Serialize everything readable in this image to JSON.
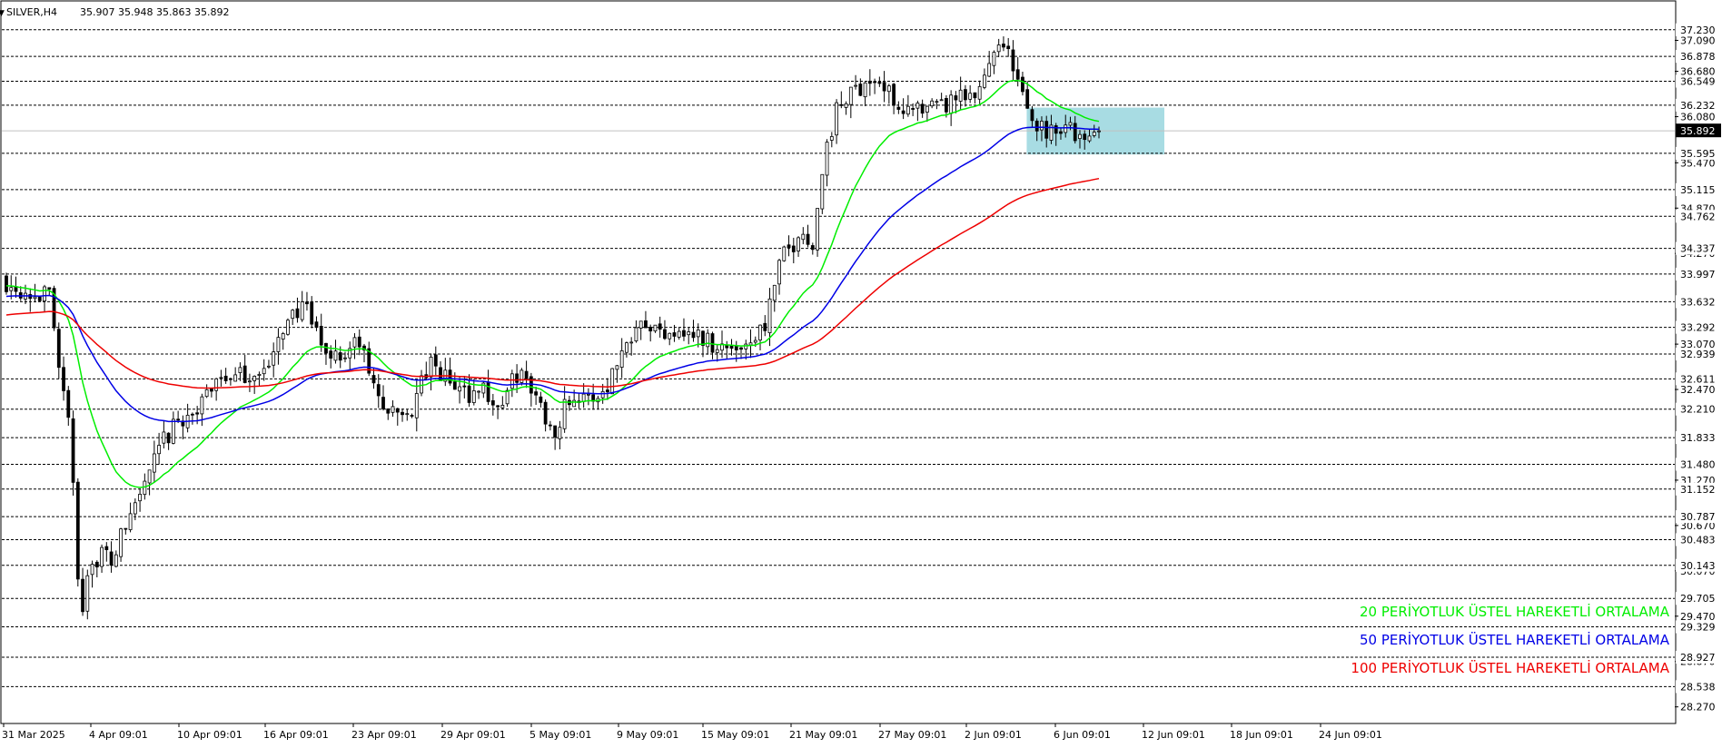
{
  "header": {
    "symbol": "SILVER,H4",
    "ohlc": "35.907 35.948 35.863 35.892"
  },
  "chart_data": {
    "type": "candlestick",
    "symbol": "SILVER",
    "timeframe": "H4",
    "y_range": [
      28.05,
      37.6
    ],
    "x_ticks": [
      "31 Mar 2025",
      "4 Apr 09:01",
      "10 Apr 09:01",
      "16 Apr 09:01",
      "23 Apr 09:01",
      "29 Apr 09:01",
      "5 May 09:01",
      "9 May 09:01",
      "15 May 09:01",
      "21 May 09:01",
      "27 May 09:01",
      "2 Jun 09:01",
      "6 Jun 09:01",
      "12 Jun 09:01",
      "18 Jun 09:01",
      "24 Jun 09:01"
    ],
    "y_ticks": [
      "37.090",
      "36.680",
      "36.080",
      "35.470",
      "34.870",
      "34.270",
      "33.070",
      "32.470",
      "31.270",
      "30.670",
      "30.070",
      "29.470",
      "28.870",
      "28.270"
    ],
    "levels": [
      {
        "label": "37.230",
        "value": 37.23
      },
      {
        "label": "36.878",
        "value": 36.878
      },
      {
        "label": "36.549",
        "value": 36.549
      },
      {
        "label": "36.232",
        "value": 36.232
      },
      {
        "label": "35.595",
        "value": 35.595
      },
      {
        "label": "35.115",
        "value": 35.115
      },
      {
        "label": "34.762",
        "value": 34.762
      },
      {
        "label": "34.337",
        "value": 34.337
      },
      {
        "label": "33.997",
        "value": 33.997
      },
      {
        "label": "33.632",
        "value": 33.632
      },
      {
        "label": "33.292",
        "value": 33.292
      },
      {
        "label": "32.939",
        "value": 32.939
      },
      {
        "label": "32.611",
        "value": 32.611
      },
      {
        "label": "32.210",
        "value": 32.21
      },
      {
        "label": "31.833",
        "value": 31.833
      },
      {
        "label": "31.480",
        "value": 31.48
      },
      {
        "label": "31.152",
        "value": 31.152
      },
      {
        "label": "30.787",
        "value": 30.787
      },
      {
        "label": "30.483",
        "value": 30.483
      },
      {
        "label": "30.143",
        "value": 30.143
      },
      {
        "label": "29.705",
        "value": 29.705
      },
      {
        "label": "29.329",
        "value": 29.329
      },
      {
        "label": "28.927",
        "value": 28.927
      },
      {
        "label": "28.538",
        "value": 28.538
      }
    ],
    "current_price": {
      "label": "35.892",
      "value": 35.892
    },
    "zone": {
      "low": 35.58,
      "high": 36.2,
      "start_x_label": "18 Jun 09:01",
      "color": "#a8dce3"
    },
    "close_path": [
      {
        "t": 0.0,
        "v": 33.9
      },
      {
        "t": 1.5,
        "v": 33.75
      },
      {
        "t": 2.5,
        "v": 33.7
      },
      {
        "t": 3.2,
        "v": 32.5
      },
      {
        "t": 3.7,
        "v": 31.7
      },
      {
        "t": 4.0,
        "v": 30.2
      },
      {
        "t": 4.2,
        "v": 29.4
      },
      {
        "t": 4.6,
        "v": 30.1
      },
      {
        "t": 5.4,
        "v": 30.3
      },
      {
        "t": 6.0,
        "v": 30.2
      },
      {
        "t": 7.0,
        "v": 30.8
      },
      {
        "t": 8.0,
        "v": 31.3
      },
      {
        "t": 9.0,
        "v": 31.8
      },
      {
        "t": 10.0,
        "v": 32.1
      },
      {
        "t": 11.0,
        "v": 32.2
      },
      {
        "t": 12.0,
        "v": 32.7
      },
      {
        "t": 13.0,
        "v": 32.6
      },
      {
        "t": 14.0,
        "v": 32.7
      },
      {
        "t": 15.0,
        "v": 32.75
      },
      {
        "t": 16.0,
        "v": 33.5
      },
      {
        "t": 17.0,
        "v": 33.5
      },
      {
        "t": 18.0,
        "v": 33.0
      },
      {
        "t": 19.0,
        "v": 32.9
      },
      {
        "t": 20.0,
        "v": 33.1
      },
      {
        "t": 21.0,
        "v": 32.4
      },
      {
        "t": 22.0,
        "v": 32.1
      },
      {
        "t": 23.0,
        "v": 32.2
      },
      {
        "t": 24.0,
        "v": 32.8
      },
      {
        "t": 25.0,
        "v": 32.6
      },
      {
        "t": 26.0,
        "v": 32.4
      },
      {
        "t": 27.0,
        "v": 32.5
      },
      {
        "t": 28.0,
        "v": 32.2
      },
      {
        "t": 29.0,
        "v": 32.7
      },
      {
        "t": 30.0,
        "v": 32.4
      },
      {
        "t": 31.0,
        "v": 31.9
      },
      {
        "t": 32.0,
        "v": 32.4
      },
      {
        "t": 33.0,
        "v": 32.3
      },
      {
        "t": 34.0,
        "v": 32.5
      },
      {
        "t": 35.0,
        "v": 33.0
      },
      {
        "t": 36.0,
        "v": 33.5
      },
      {
        "t": 37.0,
        "v": 33.2
      },
      {
        "t": 38.0,
        "v": 33.3
      },
      {
        "t": 39.0,
        "v": 33.2
      },
      {
        "t": 40.0,
        "v": 33.1
      },
      {
        "t": 41.0,
        "v": 33.0
      },
      {
        "t": 42.0,
        "v": 33.1
      },
      {
        "t": 43.0,
        "v": 33.3
      },
      {
        "t": 44.0,
        "v": 34.2
      },
      {
        "t": 45.0,
        "v": 34.5
      },
      {
        "t": 45.8,
        "v": 34.45
      },
      {
        "t": 46.4,
        "v": 35.5
      },
      {
        "t": 47.0,
        "v": 36.1
      },
      {
        "t": 48.0,
        "v": 36.4
      },
      {
        "t": 49.0,
        "v": 36.6
      },
      {
        "t": 50.0,
        "v": 36.4
      },
      {
        "t": 51.0,
        "v": 36.2
      },
      {
        "t": 52.0,
        "v": 36.1
      },
      {
        "t": 53.0,
        "v": 36.2
      },
      {
        "t": 54.0,
        "v": 36.3
      },
      {
        "t": 55.0,
        "v": 36.3
      },
      {
        "t": 56.0,
        "v": 37.0
      },
      {
        "t": 56.5,
        "v": 37.15
      },
      {
        "t": 57.3,
        "v": 36.6
      },
      {
        "t": 58.0,
        "v": 36.1
      },
      {
        "t": 59.0,
        "v": 35.9
      },
      {
        "t": 60.0,
        "v": 36.0
      },
      {
        "t": 60.8,
        "v": 35.8
      },
      {
        "t": 61.2,
        "v": 35.7
      },
      {
        "t": 62.0,
        "v": 35.892
      }
    ],
    "series": [
      {
        "name": "20 PERİYOTLUK ÜSTEL HAREKETLİ ORTALAMA",
        "period": 20,
        "color": "#00ee00"
      },
      {
        "name": "50 PERİYOTLUK ÜSTEL HAREKETLİ ORTALAMA",
        "period": 50,
        "color": "#0000e6"
      },
      {
        "name": "100 PERİYOTLUK ÜSTEL HAREKETLİ ORTALAMA",
        "period": 100,
        "color": "#ee0000"
      }
    ],
    "candle_colors": {
      "bar": "#000000",
      "bull_fill": "#ffffff",
      "bear_fill": "#000000"
    },
    "grid": false,
    "legend_position": "bottom-right"
  }
}
